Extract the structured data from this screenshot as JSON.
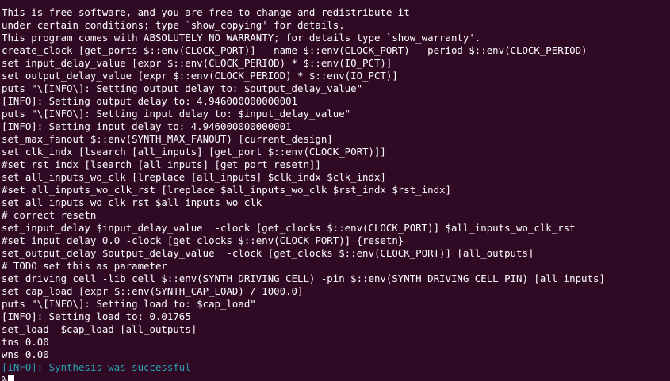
{
  "terminal": {
    "colors": {
      "background": "#300a24",
      "foreground": "#ffffff",
      "success_info": "#2aa1b3"
    },
    "lines": [
      {
        "text": "This is free software, and you are free to change and redistribute it",
        "style": "normal"
      },
      {
        "text": "under certain conditions; type `show_copying' for details.",
        "style": "normal"
      },
      {
        "text": "This program comes with ABSOLUTELY NO WARRANTY; for details type `show_warranty'.",
        "style": "normal"
      },
      {
        "text": "create_clock [get_ports $::env(CLOCK_PORT)]  -name $::env(CLOCK_PORT)  -period $::env(CLOCK_PERIOD)",
        "style": "normal"
      },
      {
        "text": "set input_delay_value [expr $::env(CLOCK_PERIOD) * $::env(IO_PCT)]",
        "style": "normal"
      },
      {
        "text": "set output_delay_value [expr $::env(CLOCK_PERIOD) * $::env(IO_PCT)]",
        "style": "normal"
      },
      {
        "text": "puts \"\\[INFO\\]: Setting output delay to: $output_delay_value\"",
        "style": "normal"
      },
      {
        "text": "[INFO]: Setting output delay to: 4.946000000000001",
        "style": "normal"
      },
      {
        "text": "puts \"\\[INFO\\]: Setting input delay to: $input_delay_value\"",
        "style": "normal"
      },
      {
        "text": "[INFO]: Setting input delay to: 4.946000000000001",
        "style": "normal"
      },
      {
        "text": "set_max_fanout $::env(SYNTH_MAX_FANOUT) [current_design]",
        "style": "normal"
      },
      {
        "text": "set clk_indx [lsearch [all_inputs] [get_port $::env(CLOCK_PORT)]]",
        "style": "normal"
      },
      {
        "text": "#set rst_indx [lsearch [all_inputs] [get_port resetn]]",
        "style": "normal"
      },
      {
        "text": "set all_inputs_wo_clk [lreplace [all_inputs] $clk_indx $clk_indx]",
        "style": "normal"
      },
      {
        "text": "#set all_inputs_wo_clk_rst [lreplace $all_inputs_wo_clk $rst_indx $rst_indx]",
        "style": "normal"
      },
      {
        "text": "set all_inputs_wo_clk_rst $all_inputs_wo_clk",
        "style": "normal"
      },
      {
        "text": "# correct resetn",
        "style": "normal"
      },
      {
        "text": "set_input_delay $input_delay_value  -clock [get_clocks $::env(CLOCK_PORT)] $all_inputs_wo_clk_rst",
        "style": "normal"
      },
      {
        "text": "#set_input_delay 0.0 -clock [get_clocks $::env(CLOCK_PORT)] {resetn}",
        "style": "normal"
      },
      {
        "text": "set_output_delay $output_delay_value  -clock [get_clocks $::env(CLOCK_PORT)] [all_outputs]",
        "style": "normal"
      },
      {
        "text": "# TODO set this as parameter",
        "style": "normal"
      },
      {
        "text": "set_driving_cell -lib_cell $::env(SYNTH_DRIVING_CELL) -pin $::env(SYNTH_DRIVING_CELL_PIN) [all_inputs]",
        "style": "normal"
      },
      {
        "text": "set cap_load [expr $::env(SYNTH_CAP_LOAD) / 1000.0]",
        "style": "normal"
      },
      {
        "text": "puts \"\\[INFO\\]: Setting load to: $cap_load\"",
        "style": "normal"
      },
      {
        "text": "[INFO]: Setting load to: 0.01765",
        "style": "normal"
      },
      {
        "text": "set_load  $cap_load [all_outputs]",
        "style": "normal"
      },
      {
        "text": "tns 0.00",
        "style": "normal"
      },
      {
        "text": "wns 0.00",
        "style": "normal"
      },
      {
        "text": "[INFO]: Synthesis was successful",
        "style": "info-success"
      }
    ],
    "prompt": "%"
  }
}
